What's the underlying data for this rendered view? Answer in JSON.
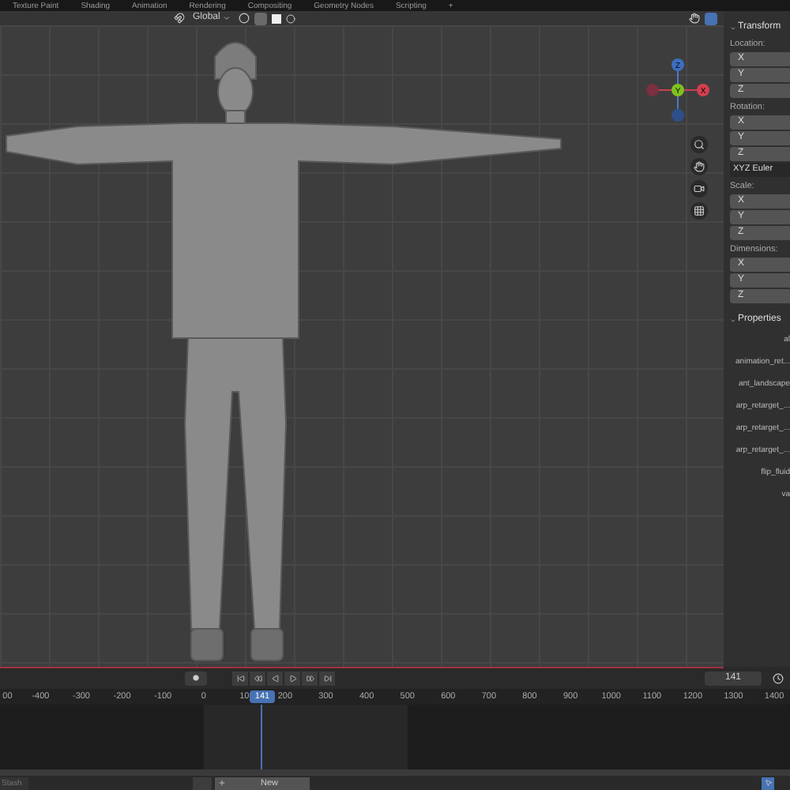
{
  "workspace_tabs": [
    "Texture Paint",
    "Shading",
    "Animation",
    "Rendering",
    "Compositing",
    "Geometry Nodes",
    "Scripting",
    "+"
  ],
  "viewport_header": {
    "orientation": "Global"
  },
  "navigation_gizmo": {
    "axes": [
      "Z",
      "Y",
      "X"
    ]
  },
  "sidebar": {
    "transform": {
      "title": "Transform",
      "groups": [
        {
          "label": "Location:",
          "fields": [
            "X",
            "Y",
            "Z"
          ]
        },
        {
          "label": "Rotation:",
          "fields": [
            "X",
            "Y",
            "Z"
          ],
          "mode": "XYZ Euler"
        },
        {
          "label": "Scale:",
          "fields": [
            "X",
            "Y",
            "Z"
          ]
        },
        {
          "label": "Dimensions:",
          "fields": [
            "X",
            "Y",
            "Z"
          ]
        }
      ]
    },
    "properties": {
      "title": "Properties",
      "items": [
        "al",
        "animation_ret...",
        "ant_landscape",
        "arp_retarget_...",
        "arp_retarget_...",
        "arp_retarget_...",
        "flip_fluid",
        "va"
      ]
    }
  },
  "timeline": {
    "current_frame": "141",
    "ruler": [
      "00",
      "-400",
      "-300",
      "-200",
      "-100",
      "0",
      "10",
      "200",
      "300",
      "400",
      "500",
      "600",
      "700",
      "800",
      "900",
      "1000",
      "1100",
      "1200",
      "1300",
      "1400"
    ],
    "playhead": "141"
  },
  "bottom_bar": {
    "stash": "Stash",
    "new": "New"
  }
}
